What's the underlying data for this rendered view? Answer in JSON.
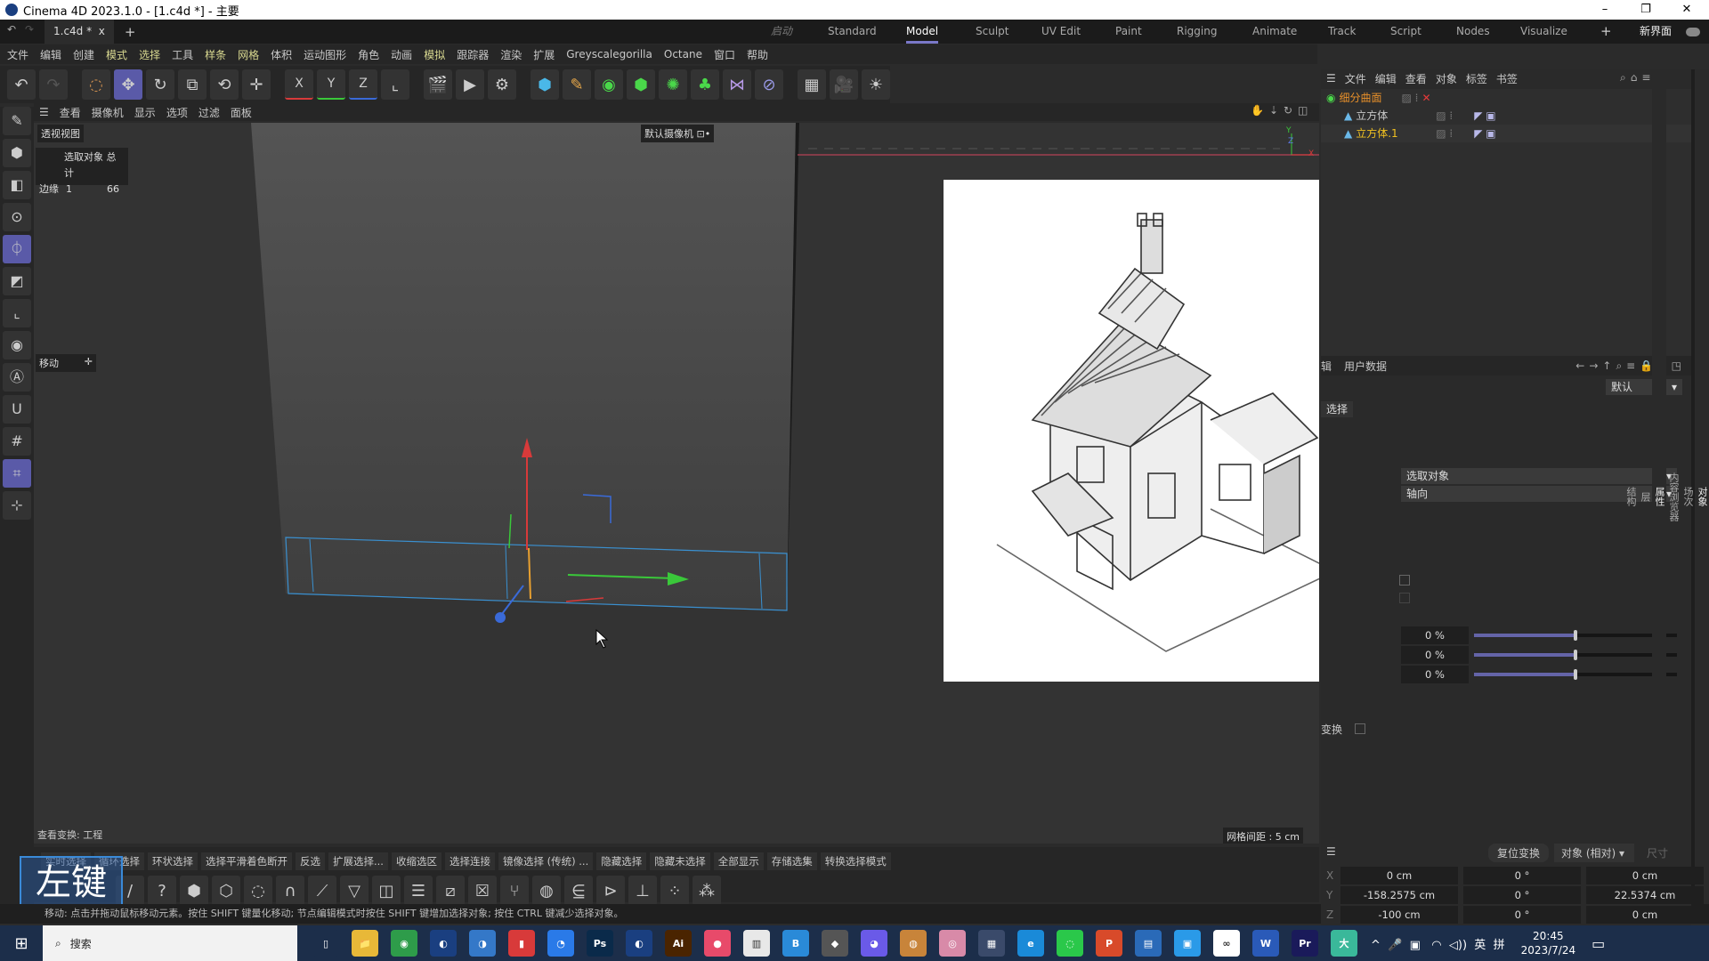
{
  "window": {
    "title": "Cinema 4D 2023.1.0 - [1.c4d *] - 主要",
    "minimize": "–",
    "maximize": "❐",
    "close": "✕"
  },
  "tabs": {
    "doc": "1.c4d *",
    "close": "x",
    "add": "+",
    "startup": "启动",
    "layouts": [
      "Standard",
      "Model",
      "Sculpt",
      "UV Edit",
      "Paint",
      "Rigging",
      "Animate",
      "Track",
      "Script",
      "Nodes",
      "Visualize"
    ],
    "active_layout": "Model",
    "new_layout": "新界面"
  },
  "menu": [
    "文件",
    "编辑",
    "创建",
    "模式",
    "选择",
    "工具",
    "样条",
    "网格",
    "体积",
    "运动图形",
    "角色",
    "动画",
    "模拟",
    "跟踪器",
    "渲染",
    "扩展",
    "Greyscalegorilla",
    "Octane",
    "窗口",
    "帮助"
  ],
  "toolbar": {
    "axis": [
      "X",
      "Y",
      "Z"
    ]
  },
  "viewmenu": [
    "查看",
    "摄像机",
    "显示",
    "选项",
    "过滤",
    "面板"
  ],
  "viewport": {
    "name": "透视视图",
    "camera": "默认摄像机 ⊡•",
    "stats_header": "选取对象 总计",
    "stats_label": "边缘",
    "stats_sel": "1",
    "stats_total": "66",
    "tool": "移动",
    "transform": "查看变换: 工程",
    "grid": "网格间距 : 5 cm",
    "axis_y": "Y",
    "axis_z": "Z",
    "axis_x": "X"
  },
  "objects": {
    "menu": [
      "文件",
      "编辑",
      "查看",
      "对象",
      "标签",
      "书签"
    ],
    "items": [
      {
        "name": "细分曲面",
        "color": "#e8902a"
      },
      {
        "name": "立方体",
        "color": "#c8c8c8"
      },
      {
        "name": "立方体.1",
        "color": "#f0c020"
      }
    ]
  },
  "attributes": {
    "tab_user": "用户数据",
    "tab_partial": "辑",
    "preset": "默认",
    "btn": "选择",
    "dd1": "选取对象",
    "dd2": "轴向",
    "sliders": [
      {
        "label": "0 %",
        "value": 0
      },
      {
        "label": "0 %",
        "value": 0
      },
      {
        "label": "0 %",
        "value": 0
      }
    ],
    "transform_label": "变换"
  },
  "right_tabs": [
    "对象",
    "场次",
    "内容浏览器",
    "属性",
    "层",
    "结构"
  ],
  "bottom_tools": [
    "实时选择",
    "循环选择",
    "环状选择",
    "选择平滑着色断开",
    "反选",
    "扩展选择...",
    "收缩选区",
    "选择连接",
    "镜像选择 (传统) ...",
    "隐藏选择",
    "隐藏未选择",
    "全部显示",
    "存储选集",
    "转换选择模式"
  ],
  "overlay_key": "左键",
  "status": "移动: 点击并拖动鼠标移动元素。按住 SHIFT 键量化移动; 节点编辑模式时按住 SHIFT 键增加选择对象; 按住 CTRL 键减少选择对象。",
  "coords": {
    "reset": "复位变换",
    "mode": "对象 (相对)",
    "size": "尺寸",
    "rows": [
      {
        "axis": "X",
        "pos": "0 cm",
        "rot": "0 °",
        "size": "0 cm"
      },
      {
        "axis": "Y",
        "pos": "-158.2575 cm",
        "rot": "0 °",
        "size": "22.5374 cm"
      },
      {
        "axis": "Z",
        "pos": "-100 cm",
        "rot": "0 °",
        "size": "0 cm"
      }
    ]
  },
  "taskbar": {
    "search": "搜索",
    "apps": [
      {
        "icon": "task-view-icon",
        "label": "▯",
        "color": "#1c2e4a"
      },
      {
        "icon": "file-explorer-icon",
        "label": "📁",
        "color": "#e8b838"
      },
      {
        "icon": "chrome-icon",
        "label": "◉",
        "color": "#2e9c4a"
      },
      {
        "icon": "cinema4d-icon",
        "label": "◐",
        "color": "#1a3f80"
      },
      {
        "icon": "app-icon",
        "label": "◑",
        "color": "#3478c8"
      },
      {
        "icon": "app-icon",
        "label": "▮",
        "color": "#d83a3a"
      },
      {
        "icon": "app-icon",
        "label": "◔",
        "color": "#2a7ae8"
      },
      {
        "icon": "photoshop-icon",
        "label": "Ps",
        "color": "#0a2a4a"
      },
      {
        "icon": "cinema4d-icon",
        "label": "◐",
        "color": "#1a3f80"
      },
      {
        "icon": "illustrator-icon",
        "label": "Ai",
        "color": "#4a2400"
      },
      {
        "icon": "app-icon",
        "label": "●",
        "color": "#e84a6a"
      },
      {
        "icon": "app-icon",
        "label": "▥",
        "color": "#e8e8e8"
      },
      {
        "icon": "app-icon",
        "label": "B",
        "color": "#2a8ad8"
      },
      {
        "icon": "app-icon",
        "label": "◆",
        "color": "#555"
      },
      {
        "icon": "app-icon",
        "label": "◕",
        "color": "#6a5ae8"
      },
      {
        "icon": "app-icon",
        "label": "◍",
        "color": "#c8843a"
      },
      {
        "icon": "app-icon",
        "label": "◎",
        "color": "#d88aa8"
      },
      {
        "icon": "calculator-icon",
        "label": "▦",
        "color": "#3a4a6a"
      },
      {
        "icon": "edge-icon",
        "label": "e",
        "color": "#1a8ad8"
      },
      {
        "icon": "wechat-icon",
        "label": "◌",
        "color": "#2ac84a"
      },
      {
        "icon": "powerpoint-icon",
        "label": "P",
        "color": "#d84a2a"
      },
      {
        "icon": "app-icon",
        "label": "▤",
        "color": "#2a6ab8"
      },
      {
        "icon": "app-icon",
        "label": "▣",
        "color": "#2a9ae8"
      },
      {
        "icon": "baidu-netdisk-icon",
        "label": "∞",
        "color": "#fff"
      },
      {
        "icon": "word-icon",
        "label": "W",
        "color": "#2a5ab8"
      },
      {
        "icon": "premiere-icon",
        "label": "Pr",
        "color": "#1a1a5a"
      },
      {
        "icon": "app-icon",
        "label": "大",
        "color": "#3ab89a"
      }
    ],
    "tray": "^  🎤  ▣   ◠  ◁))  英  拼",
    "time": "20:45",
    "date": "2023/7/24"
  },
  "colors": {
    "accent": "#5a5aa8",
    "x_axis": "#d83a3a",
    "y_axis": "#3ac83a",
    "z_axis": "#3a6ad8"
  }
}
